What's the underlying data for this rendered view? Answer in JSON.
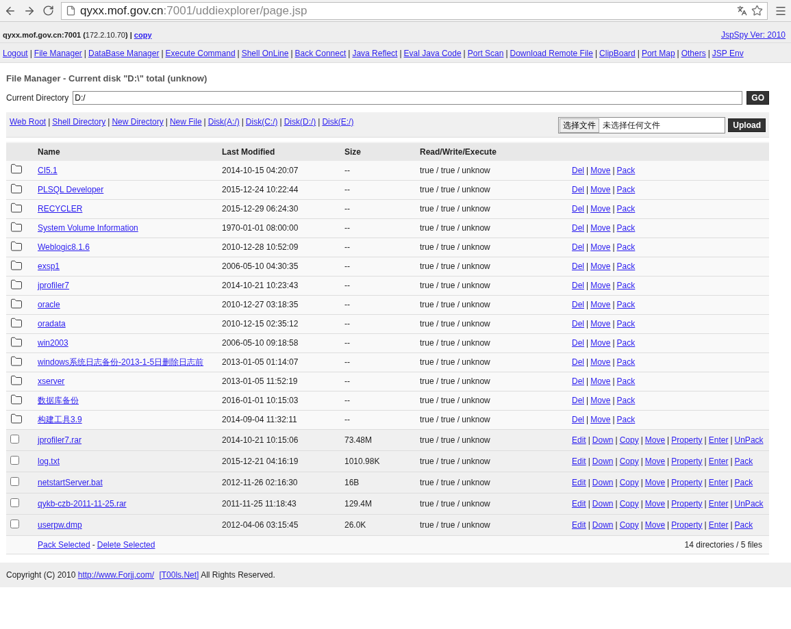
{
  "browser": {
    "url_host": "qyxx.mof.gov.cn",
    "url_rest": ":7001/uddiexplorer/page.jsp"
  },
  "header": {
    "info": "**qyxx.mof.gov.cn:7001 (**172.2.10.70**) |**",
    "copy_link": "copy",
    "version_link": "JspSpy Ver: 2010"
  },
  "nav": {
    "separator": "|",
    "items": [
      "Logout",
      "File Manager",
      "DataBase Manager",
      "Execute Command",
      "Shell OnLine",
      "Back Connect",
      "Java Reflect",
      "Eval Java Code",
      "Port Scan",
      "Download Remote File",
      "ClipBoard",
      "Port Map",
      "Others",
      "JSP Env"
    ]
  },
  "title": "File Manager - Current disk \"D:\\\" total (unknow)",
  "current_directory": {
    "label": "Current Directory",
    "value": "D:/",
    "button": "GO"
  },
  "toolbar": {
    "separator": "|",
    "links": [
      "Web Root",
      "Shell Directory",
      "New Directory",
      "New File",
      "Disk(A:/)",
      "Disk(C:/)",
      "Disk(D:/)",
      "Disk(E:/)"
    ],
    "file_button": "选择文件",
    "file_status": "未选择任何文件",
    "upload": "Upload"
  },
  "table": {
    "columns": [
      "Name",
      "Last Modified",
      "Size",
      "Read/Write/Execute"
    ],
    "action_separator": "|",
    "rows": [
      {
        "kind": "directory",
        "name": "CI5.1",
        "modified": "2014-10-15 04:20:07",
        "size": "--",
        "permissions": "true / true / unknow",
        "actions": [
          "Del",
          "Move",
          "Pack"
        ]
      },
      {
        "kind": "directory",
        "name": "PLSQL Developer",
        "modified": "2015-12-24 10:22:44",
        "size": "--",
        "permissions": "true / true / unknow",
        "actions": [
          "Del",
          "Move",
          "Pack"
        ]
      },
      {
        "kind": "directory",
        "name": "RECYCLER",
        "modified": "2015-12-29 06:24:30",
        "size": "--",
        "permissions": "true / true / unknow",
        "actions": [
          "Del",
          "Move",
          "Pack"
        ]
      },
      {
        "kind": "directory",
        "name": "System Volume Information",
        "modified": "1970-01-01 08:00:00",
        "size": "--",
        "permissions": "true / true / unknow",
        "actions": [
          "Del",
          "Move",
          "Pack"
        ]
      },
      {
        "kind": "directory",
        "name": "Weblogic8.1.6",
        "modified": "2010-12-28 10:52:09",
        "size": "--",
        "permissions": "true / true / unknow",
        "actions": [
          "Del",
          "Move",
          "Pack"
        ]
      },
      {
        "kind": "directory",
        "name": "exsp1",
        "modified": "2006-05-10 04:30:35",
        "size": "--",
        "permissions": "true / true / unknow",
        "actions": [
          "Del",
          "Move",
          "Pack"
        ]
      },
      {
        "kind": "directory",
        "name": "jprofiler7",
        "modified": "2014-10-21 10:23:43",
        "size": "--",
        "permissions": "true / true / unknow",
        "actions": [
          "Del",
          "Move",
          "Pack"
        ]
      },
      {
        "kind": "directory",
        "name": "oracle",
        "modified": "2010-12-27 03:18:35",
        "size": "--",
        "permissions": "true / true / unknow",
        "actions": [
          "Del",
          "Move",
          "Pack"
        ]
      },
      {
        "kind": "directory",
        "name": "oradata",
        "modified": "2010-12-15 02:35:12",
        "size": "--",
        "permissions": "true / true / unknow",
        "actions": [
          "Del",
          "Move",
          "Pack"
        ]
      },
      {
        "kind": "directory",
        "name": "win2003",
        "modified": "2006-05-10 09:18:58",
        "size": "--",
        "permissions": "true / true / unknow",
        "actions": [
          "Del",
          "Move",
          "Pack"
        ]
      },
      {
        "kind": "directory",
        "name": "windows系统日志备份-2013-1-5日删除日志前",
        "modified": "2013-01-05 01:14:07",
        "size": "--",
        "permissions": "true / true / unknow",
        "actions": [
          "Del",
          "Move",
          "Pack"
        ]
      },
      {
        "kind": "directory",
        "name": "xserver",
        "modified": "2013-01-05 11:52:19",
        "size": "--",
        "permissions": "true / true / unknow",
        "actions": [
          "Del",
          "Move",
          "Pack"
        ]
      },
      {
        "kind": "directory",
        "name": "数据库备份",
        "modified": "2016-01-01 10:15:03",
        "size": "--",
        "permissions": "true / true / unknow",
        "actions": [
          "Del",
          "Move",
          "Pack"
        ]
      },
      {
        "kind": "directory",
        "name": "构建工具3.9",
        "modified": "2014-09-04 11:32:11",
        "size": "--",
        "permissions": "true / true / unknow",
        "actions": [
          "Del",
          "Move",
          "Pack"
        ]
      },
      {
        "kind": "file",
        "checked": false,
        "name": "jprofiler7.rar",
        "modified": "2014-10-21 10:15:06",
        "size": "73.48M",
        "permissions": "true / true / unknow",
        "actions": [
          "Edit",
          "Down",
          "Copy",
          "Move",
          "Property",
          "Enter",
          "UnPack"
        ]
      },
      {
        "kind": "file",
        "checked": false,
        "name": "log.txt",
        "modified": "2015-12-21 04:16:19",
        "size": "1010.98K",
        "permissions": "true / true / unknow",
        "actions": [
          "Edit",
          "Down",
          "Copy",
          "Move",
          "Property",
          "Enter",
          "Pack"
        ]
      },
      {
        "kind": "file",
        "checked": false,
        "name": "netstartServer.bat",
        "modified": "2012-11-26 02:16:30",
        "size": "16B",
        "permissions": "true / true / unknow",
        "actions": [
          "Edit",
          "Down",
          "Copy",
          "Move",
          "Property",
          "Enter",
          "Pack"
        ]
      },
      {
        "kind": "file",
        "checked": false,
        "name": "qykb-czb-2011-11-25.rar",
        "modified": "2011-11-25 11:18:43",
        "size": "129.4M",
        "permissions": "true / true / unknow",
        "actions": [
          "Edit",
          "Down",
          "Copy",
          "Move",
          "Property",
          "Enter",
          "UnPack"
        ]
      },
      {
        "kind": "file",
        "checked": false,
        "name": "userpw.dmp",
        "modified": "2012-04-06 03:15:45",
        "size": "26.0K",
        "permissions": "true / true / unknow",
        "actions": [
          "Edit",
          "Down",
          "Copy",
          "Move",
          "Property",
          "Enter",
          "Pack"
        ]
      }
    ]
  },
  "footer_row": {
    "links": [
      "Pack Selected",
      "Delete Selected"
    ],
    "separator": "-",
    "summary": "14 directories / 5 files"
  },
  "copyright": {
    "prefix": "Copyright (C) 2010",
    "links": [
      "http://www.Forjj.com/",
      "[T00ls.Net]"
    ],
    "suffix": "All Rights Reserved."
  }
}
